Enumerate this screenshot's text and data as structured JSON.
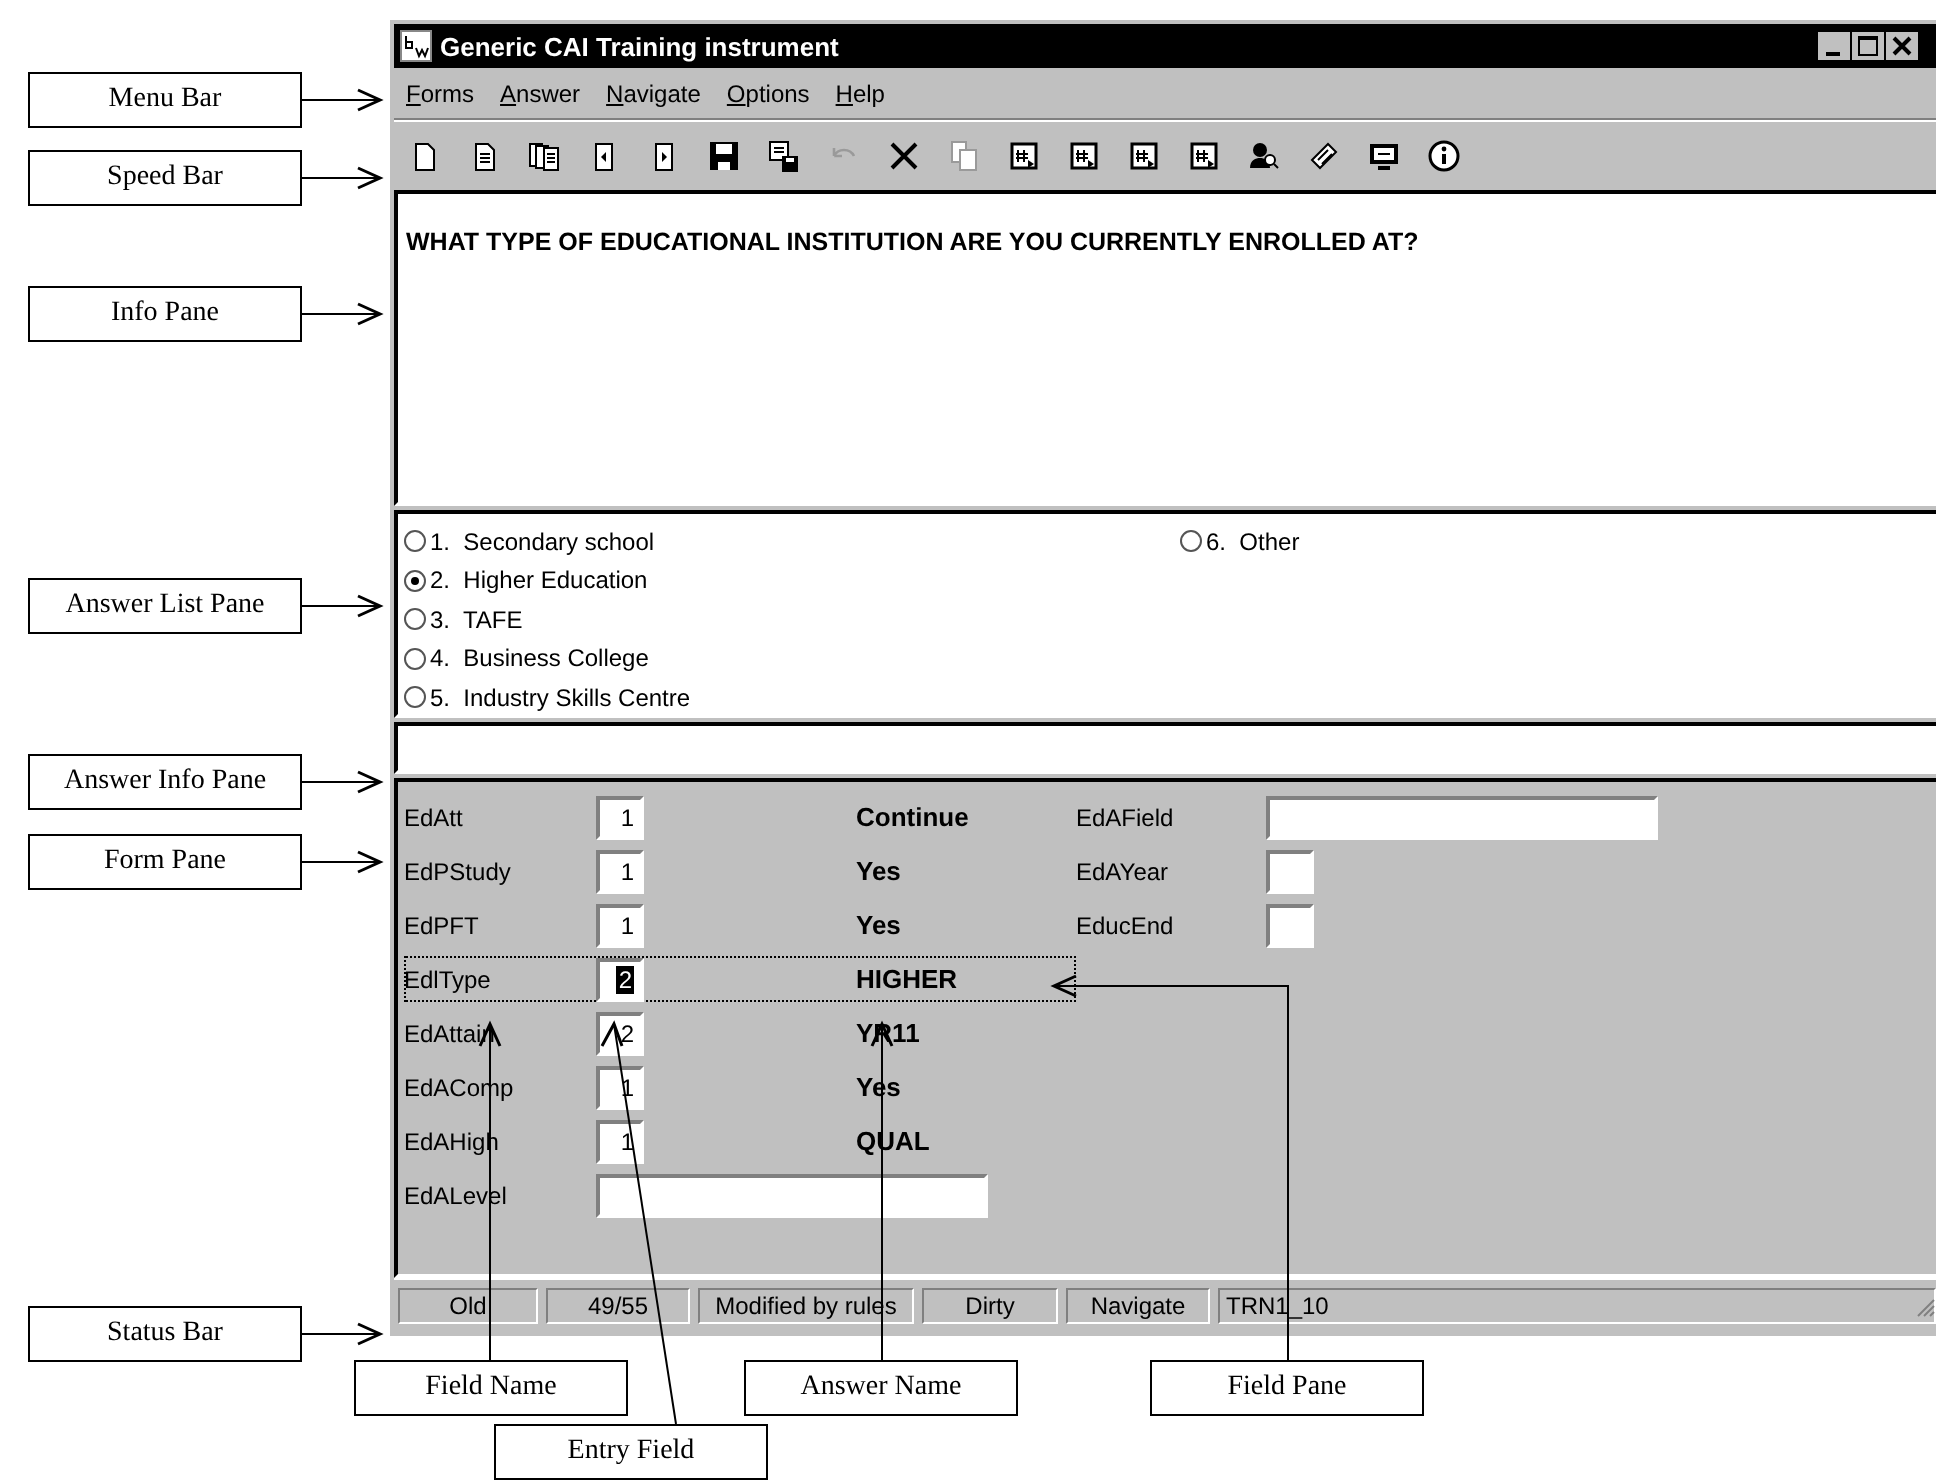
{
  "window": {
    "title": "Generic CAI Training instrument"
  },
  "menu": [
    "Forms",
    "Answer",
    "Navigate",
    "Options",
    "Help"
  ],
  "toolbar": [
    {
      "kind": "page",
      "disabled": false
    },
    {
      "kind": "document",
      "disabled": false
    },
    {
      "kind": "documents",
      "disabled": false
    },
    {
      "kind": "page-left",
      "disabled": false
    },
    {
      "kind": "page-right",
      "disabled": false
    },
    {
      "kind": "save",
      "disabled": false
    },
    {
      "kind": "save-doc",
      "disabled": false
    },
    {
      "kind": "undo",
      "disabled": true
    },
    {
      "kind": "cross",
      "disabled": false
    },
    {
      "kind": "copy",
      "disabled": true
    },
    {
      "kind": "hash",
      "disabled": false
    },
    {
      "kind": "hash",
      "disabled": false
    },
    {
      "kind": "hash",
      "disabled": false
    },
    {
      "kind": "hash",
      "disabled": false
    },
    {
      "kind": "person",
      "disabled": false
    },
    {
      "kind": "tag",
      "disabled": false
    },
    {
      "kind": "monitor",
      "disabled": false
    },
    {
      "kind": "info",
      "disabled": false
    }
  ],
  "info_pane": {
    "question": "WHAT TYPE OF EDUCATIONAL INSTITUTION ARE YOU CURRENTLY ENROLLED AT?"
  },
  "answer_list": [
    {
      "label": "1.  Secondary school",
      "selected": false
    },
    {
      "label": "2.  Higher Education",
      "selected": true
    },
    {
      "label": "3.  TAFE",
      "selected": false
    },
    {
      "label": "4.  Business College",
      "selected": false
    },
    {
      "label": "5.  Industry Skills Centre",
      "selected": false
    },
    {
      "label": "6.  Other",
      "selected": false
    }
  ],
  "form_pane": {
    "left": [
      {
        "name": "EdAtt",
        "kind": "short",
        "value": "1",
        "answer": "Continue",
        "focused": false
      },
      {
        "name": "EdPStudy",
        "kind": "short",
        "value": "1",
        "answer": "Yes",
        "focused": false
      },
      {
        "name": "EdPFT",
        "kind": "short",
        "value": "1",
        "answer": "Yes",
        "focused": false
      },
      {
        "name": "EdlType",
        "kind": "short",
        "value": "2",
        "answer": "HIGHER",
        "focused": true
      },
      {
        "name": "EdAttain",
        "kind": "short",
        "value": "2",
        "answer": "YR11",
        "focused": false
      },
      {
        "name": "EdAComp",
        "kind": "short",
        "value": "1",
        "answer": "Yes",
        "focused": false
      },
      {
        "name": "EdAHigh",
        "kind": "short",
        "value": "1",
        "answer": "QUAL",
        "focused": false
      },
      {
        "name": "EdALevel",
        "kind": "long",
        "focused": false
      }
    ],
    "right": [
      {
        "name": "EdAField",
        "kind": "long"
      },
      {
        "name": "EdAYear",
        "kind": "short"
      },
      {
        "name": "EducEnd",
        "kind": "short"
      }
    ]
  },
  "status_bar": [
    "Old",
    "49/55",
    "Modified by rules",
    "Dirty",
    "Navigate",
    "TRN1_10"
  ],
  "callouts_left": [
    "Menu Bar",
    "Speed Bar",
    "Info Pane",
    "Answer List Pane",
    "Answer Info Pane",
    "Form Pane",
    "Status Bar"
  ],
  "callouts_bottom": [
    "Field Name",
    "Entry Field",
    "Answer Name",
    "Field Pane"
  ]
}
